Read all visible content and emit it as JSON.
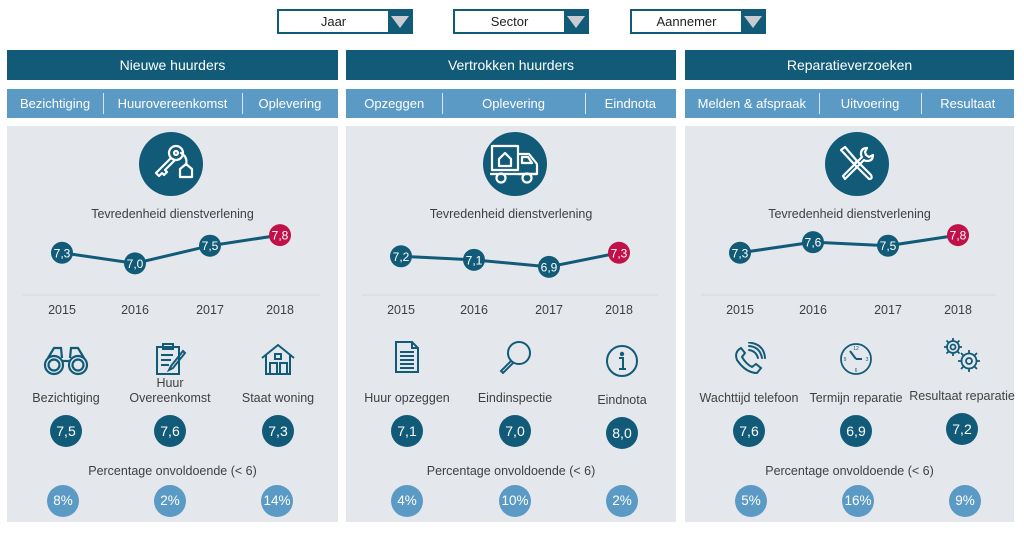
{
  "filters": [
    {
      "label": "Jaar"
    },
    {
      "label": "Sector"
    },
    {
      "label": "Aannemer"
    }
  ],
  "colors": {
    "primary": "#125b78",
    "secondary": "#5b9ac4",
    "highlight": "#c0114a",
    "panel_bg": "#e4e8ec"
  },
  "panels": [
    {
      "title": "Nieuwe huurders",
      "tabs": [
        "Bezichtiging",
        "Huurovereenkomst",
        "Oplevering"
      ],
      "main_icon": "key-house-icon",
      "chart_title": "Tevredenheid dienstverlening",
      "years": [
        "2015",
        "2016",
        "2017",
        "2018"
      ],
      "values": [
        7.3,
        7.0,
        7.5,
        7.8
      ],
      "value_labels": [
        "7,3",
        "7,0",
        "7,5",
        "7,8"
      ],
      "items": [
        {
          "icon": "binoculars-icon",
          "label": "Bezichtiging",
          "score": "7,5"
        },
        {
          "icon": "clipboard-pen-icon",
          "label": "Huur Overeenkomst",
          "score": "7,6"
        },
        {
          "icon": "house-icon",
          "label": "Staat woning",
          "score": "7,3"
        }
      ],
      "pct_title": "Percentage onvoldoende (< 6)",
      "percentages": [
        "8%",
        "2%",
        "14%"
      ]
    },
    {
      "title": "Vertrokken huurders",
      "tabs": [
        "Opzeggen",
        "Oplevering",
        "Eindnota"
      ],
      "main_icon": "moving-truck-icon",
      "chart_title": "Tevredenheid dienstverlening",
      "years": [
        "2015",
        "2016",
        "2017",
        "2018"
      ],
      "values": [
        7.2,
        7.1,
        6.9,
        7.3
      ],
      "value_labels": [
        "7,2",
        "7,1",
        "6,9",
        "7,3"
      ],
      "items": [
        {
          "icon": "document-icon",
          "label": "Huur opzeggen",
          "score": "7,1"
        },
        {
          "icon": "magnifier-icon",
          "label": "Eindinspectie",
          "score": "7,0"
        },
        {
          "icon": "info-icon",
          "label": "Eindnota",
          "score": "8,0"
        }
      ],
      "pct_title": "Percentage onvoldoende (< 6)",
      "percentages": [
        "4%",
        "10%",
        "2%"
      ]
    },
    {
      "title": "Reparatieverzoeken",
      "tabs": [
        "Melden & afspraak",
        "Uitvoering",
        "Resultaat"
      ],
      "main_icon": "tools-icon",
      "chart_title": "Tevredenheid dienstverlening",
      "years": [
        "2015",
        "2016",
        "2017",
        "2018"
      ],
      "values": [
        7.3,
        7.6,
        7.5,
        7.8
      ],
      "value_labels": [
        "7,3",
        "7,6",
        "7,5",
        "7,8"
      ],
      "items": [
        {
          "icon": "phone-icon",
          "label": "Wachttijd telefoon",
          "score": "7,6"
        },
        {
          "icon": "clock-icon",
          "label": "Termijn reparatie",
          "score": "6,9"
        },
        {
          "icon": "gears-icon",
          "label": "Resultaat reparatie",
          "score": "7,2"
        }
      ],
      "pct_title": "Percentage onvoldoende (< 6)",
      "percentages": [
        "5%",
        "16%",
        "9%"
      ]
    }
  ]
}
